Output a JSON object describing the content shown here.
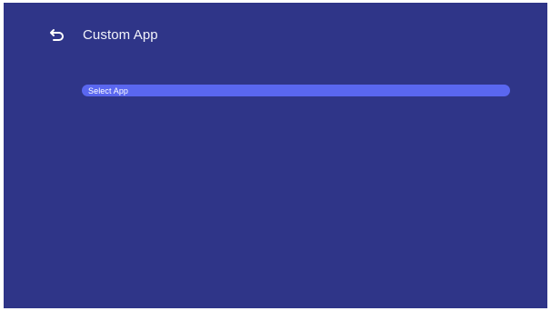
{
  "header": {
    "back_icon": "back-arrow-icon",
    "title": "Custom App"
  },
  "menu": {
    "items": [
      {
        "label": "Select App",
        "selected": true
      }
    ]
  },
  "colors": {
    "background": "#2f3588",
    "highlight": "#5a67f0",
    "text": "#ffffff"
  }
}
